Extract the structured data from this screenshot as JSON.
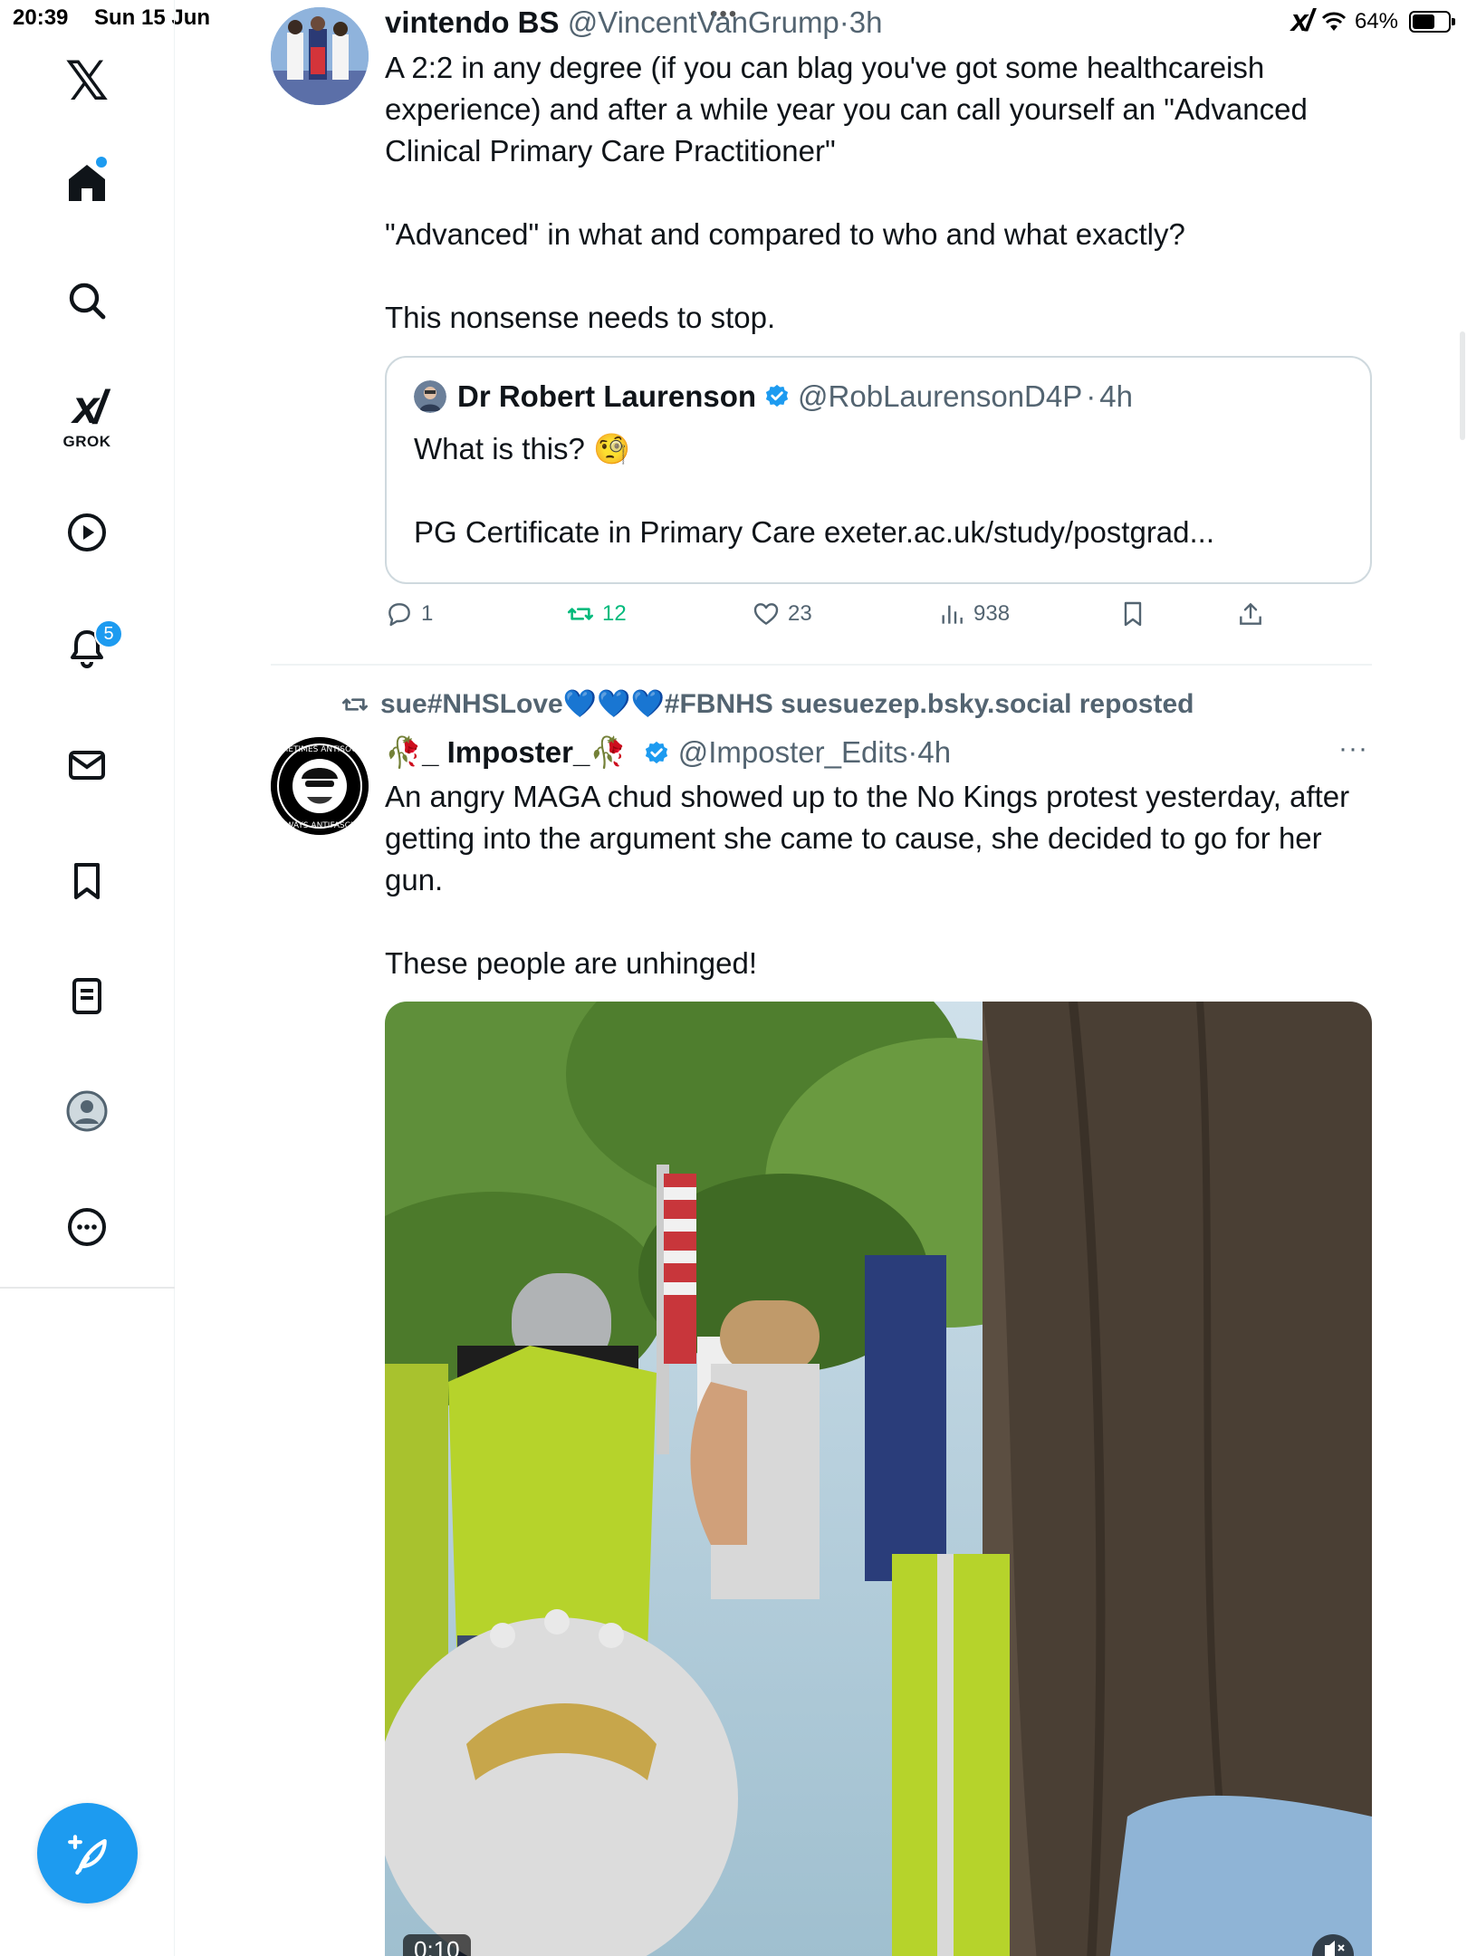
{
  "status_bar": {
    "time": "20:39",
    "date": "Sun 15 Jun",
    "battery_percent": "64%",
    "battery_level": 0.64
  },
  "sidebar": {
    "items": [
      {
        "name": "home",
        "icon": "home-icon"
      },
      {
        "name": "explore",
        "icon": "search-icon"
      },
      {
        "name": "grok",
        "icon": "grok-icon",
        "label": "GROK"
      },
      {
        "name": "video",
        "icon": "play-icon"
      },
      {
        "name": "notifications",
        "icon": "bell-icon",
        "badge": "5"
      },
      {
        "name": "messages",
        "icon": "mail-icon"
      },
      {
        "name": "bookmarks",
        "icon": "bookmark-icon"
      },
      {
        "name": "lists",
        "icon": "list-icon"
      },
      {
        "name": "profile",
        "icon": "avatar-icon"
      },
      {
        "name": "more",
        "icon": "more-icon"
      }
    ],
    "accent": "#1d9bf0"
  },
  "tweet1": {
    "display_name": "vintendo BS",
    "handle": "@VincentVanGrump",
    "time": "3h",
    "text": "A 2:2 in any degree (if you can blag you've got some healthcareish experience) and after a while year you can call yourself an \"Advanced Clinical Primary Care Practitioner\"\n\n\"Advanced\" in what and compared to who and what exactly?\n\nThis nonsense needs to stop.",
    "quote": {
      "display_name": "Dr Robert Laurenson",
      "handle": "@RobLaurensonD4P",
      "time": "4h",
      "text": "What is this? 🧐\n\nPG Certificate in Primary Care exeter.ac.uk/study/postgrad..."
    },
    "actions": {
      "replies": "1",
      "reposts": "12",
      "likes": "23",
      "views": "938"
    }
  },
  "tweet2": {
    "repost_label": "sue#NHSLove💙💙💙#FBNHS suesuezep.bsky.social reposted",
    "display_name": "🥀_ Imposter_🥀",
    "handle": "@Imposter_Edits",
    "time": "4h",
    "more": "···",
    "text": "An angry MAGA chud showed up to the No Kings protest yesterday, after getting into the argument she came to cause, she decided to go for her gun.\n\nThese people are unhinged!",
    "video": {
      "timecode": "0:10"
    }
  },
  "colors": {
    "accent": "#1d9bf0",
    "repost_green": "#00ba7c",
    "secondary_text": "#536471",
    "border": "#cfd9de"
  }
}
